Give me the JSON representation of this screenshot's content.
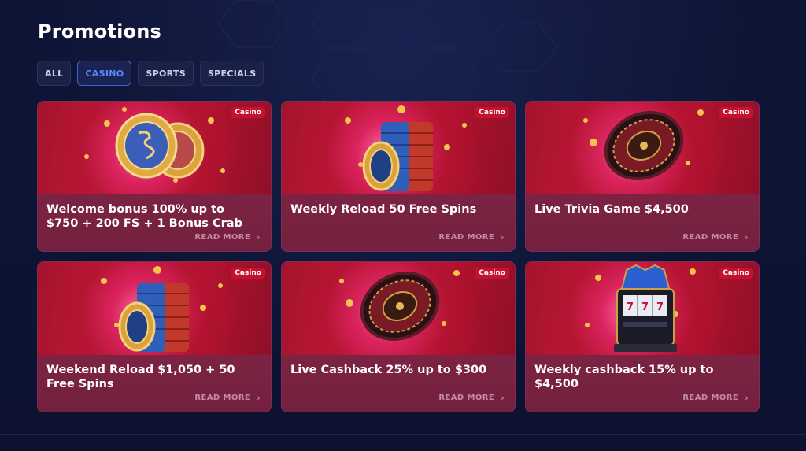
{
  "page": {
    "title": "Promotions"
  },
  "tabs": [
    {
      "label": "ALL",
      "active": false
    },
    {
      "label": "CASINO",
      "active": true
    },
    {
      "label": "SPORTS",
      "active": false
    },
    {
      "label": "SPECIALS",
      "active": false
    }
  ],
  "promotions": [
    {
      "badge": "Casino",
      "title": "Welcome bonus 100% up to $750 + 200 FS + 1 Bonus Crab",
      "cta": "READ MORE",
      "art": "coins-icon"
    },
    {
      "badge": "Casino",
      "title": "Weekly Reload 50 Free Spins",
      "cta": "READ MORE",
      "art": "chip-stack-icon"
    },
    {
      "badge": "Casino",
      "title": "Live Trivia Game $4,500",
      "cta": "READ MORE",
      "art": "roulette-wheel-icon"
    },
    {
      "badge": "Casino",
      "title": "Weekend Reload $1,050 + 50 Free Spins",
      "cta": "READ MORE",
      "art": "chip-stack-icon"
    },
    {
      "badge": "Casino",
      "title": "Live Cashback 25% up to $300",
      "cta": "READ MORE",
      "art": "roulette-wheel-icon"
    },
    {
      "badge": "Casino",
      "title": "Weekly cashback 15% up to $4,500",
      "cta": "READ MORE",
      "art": "slot-machine-icon"
    }
  ],
  "colors": {
    "background": "#0e1433",
    "accent": "#3f66d6",
    "badge": "#c4122f",
    "card": "#74203f"
  }
}
